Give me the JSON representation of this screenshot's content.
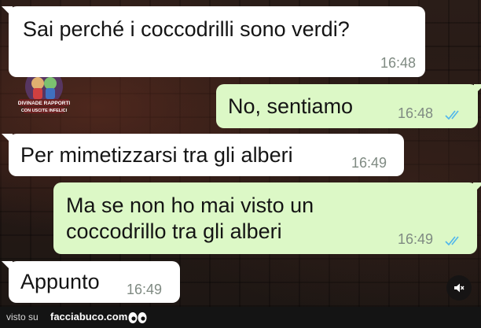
{
  "messages": [
    {
      "direction": "incoming",
      "text": "Sai perché i coccodrilli sono verdi?",
      "time": "16:48"
    },
    {
      "direction": "outgoing",
      "text": "No, sentiamo",
      "time": "16:48",
      "read": true
    },
    {
      "direction": "incoming",
      "text": "Per mimetizzarsi tra gli alberi",
      "time": "16:49"
    },
    {
      "direction": "outgoing",
      "text": "Ma se non ho mai visto un coccodrillo tra gli alberi",
      "time": "16:49",
      "read": true
    },
    {
      "direction": "incoming",
      "text": "Appunto",
      "time": "16:49"
    }
  ],
  "watermark": {
    "line1": "DIVINADE RAPPORTI",
    "line2": "CON USCITE INFELICI"
  },
  "footer": {
    "visto_su": "visto su",
    "brand": "facciabuco.com"
  },
  "icons": {
    "read_ticks": "double-check-icon",
    "mute": "speaker-mute-icon",
    "footer_logo": "eyes-icon"
  },
  "colors": {
    "incoming_bubble": "#ffffff",
    "outgoing_bubble": "#dcf8c6",
    "read_ticks": "#4fb6ec",
    "timestamp": "#7f8a82"
  }
}
